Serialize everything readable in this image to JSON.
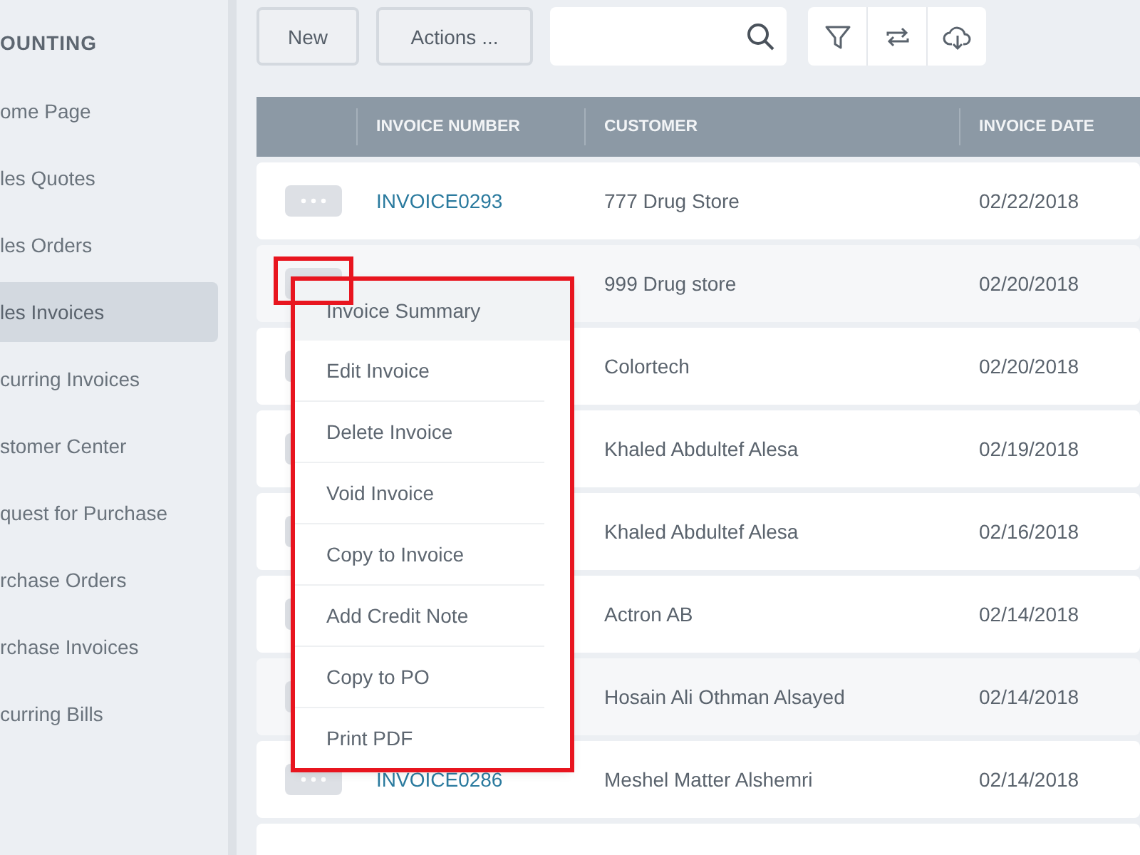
{
  "sidebar": {
    "section_title": "OUNTING",
    "items": [
      {
        "label": "ome Page",
        "selected": false
      },
      {
        "label": "les Quotes",
        "selected": false
      },
      {
        "label": "les Orders",
        "selected": false
      },
      {
        "label": "les Invoices",
        "selected": true
      },
      {
        "label": "curring Invoices",
        "selected": false
      },
      {
        "label": "stomer Center",
        "selected": false
      },
      {
        "label": "quest for Purchase",
        "selected": false
      },
      {
        "label": "rchase Orders",
        "selected": false
      },
      {
        "label": "rchase Invoices",
        "selected": false
      },
      {
        "label": "curring Bills",
        "selected": false
      }
    ]
  },
  "toolbar": {
    "buttons": [
      "New",
      "Actions ..."
    ]
  },
  "table": {
    "columns": [
      "INVOICE NUMBER",
      "CUSTOMER",
      "INVOICE DATE"
    ],
    "rows": [
      {
        "invoice_number": "INVOICE0293",
        "customer": "777 Drug Store",
        "invoice_date": "02/22/2018"
      },
      {
        "customer": "999 Drug store",
        "invoice_date": "02/20/2018"
      },
      {
        "customer": "Colortech",
        "invoice_date": "02/20/2018"
      },
      {
        "customer": "Khaled Abdultef Alesa",
        "invoice_date": "02/19/2018"
      },
      {
        "customer": "Khaled Abdultef Alesa",
        "invoice_date": "02/16/2018"
      },
      {
        "customer": "Actron AB",
        "invoice_date": "02/14/2018"
      },
      {
        "customer": "Hosain Ali Othman Alsayed",
        "invoice_date": "02/14/2018"
      },
      {
        "invoice_number": "INVOICE0286",
        "customer": "Meshel Matter Alshemri",
        "invoice_date": "02/14/2018"
      }
    ]
  },
  "context_menu": {
    "items": [
      {
        "label": "Invoice Summary",
        "selected": true
      },
      {
        "label": "Edit Invoice",
        "selected": false
      },
      {
        "label": "Delete Invoice",
        "selected": false
      },
      {
        "label": "Void Invoice",
        "selected": false
      },
      {
        "label": "Copy to Invoice",
        "selected": false
      },
      {
        "label": "Add Credit Note",
        "selected": false
      },
      {
        "label": "Copy to PO",
        "selected": false
      },
      {
        "label": "Print PDF",
        "selected": false
      }
    ]
  }
}
